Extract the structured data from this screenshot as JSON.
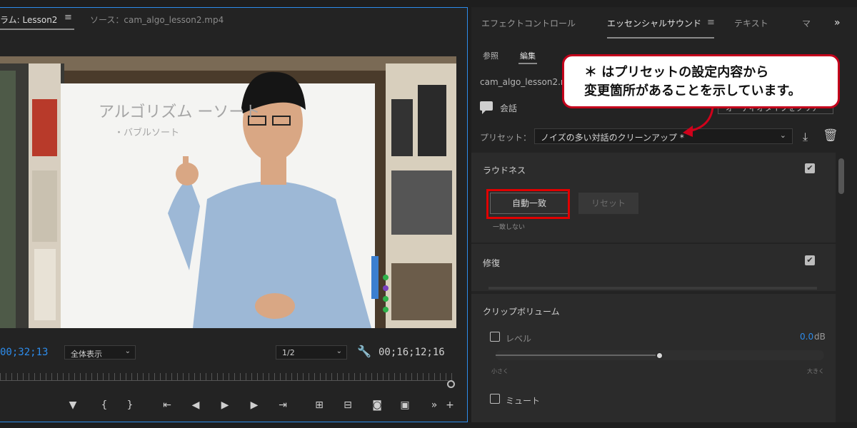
{
  "monitor": {
    "program_tab": "ラム: Lesson2",
    "tab_menu": "≡",
    "source_tab": "ソース：cam_algo_lesson2.mp4",
    "timecode": "00;32;13",
    "fit": "全体表示",
    "resolution": "1/2",
    "duration": "00;16;12;16",
    "whiteboard_text": "アルゴリズム ーソート",
    "whiteboard_sub": "・バブルソート"
  },
  "panel": {
    "tabs": [
      "エフェクトコントロール",
      "エッセンシャルサウンド",
      "≡",
      "テキスト",
      "マ",
      "»"
    ],
    "sub_tabs": [
      "参照",
      "編集"
    ],
    "clip_name": "cam_algo_lesson2.m",
    "talk_label": "会話",
    "assign_button": "オーディオタイプをクリア",
    "preset_label": "プリセット：",
    "preset_value": "ノイズの多い対話のクリーンアップ *",
    "loudness": {
      "title": "ラウドネス",
      "auto_match": "自動一致",
      "reset": "リセット",
      "status": "一致しない"
    },
    "repair": {
      "title": "修復"
    },
    "clip_volume": {
      "title": "クリップボリューム",
      "level_label": "レベル",
      "level_value": "0.0",
      "level_unit": "dB",
      "quiet_label": "小さく",
      "loud_label": "大きく",
      "level_fraction": 0.5,
      "mute_label": "ミュート"
    }
  },
  "callout": {
    "line1": "＊ はプリセットの設定内容から",
    "line2": "変更箇所があることを示しています。"
  },
  "colors": {
    "accent": "#2d8ceb",
    "highlight": "#e00000",
    "callout_border": "#c3001b"
  }
}
